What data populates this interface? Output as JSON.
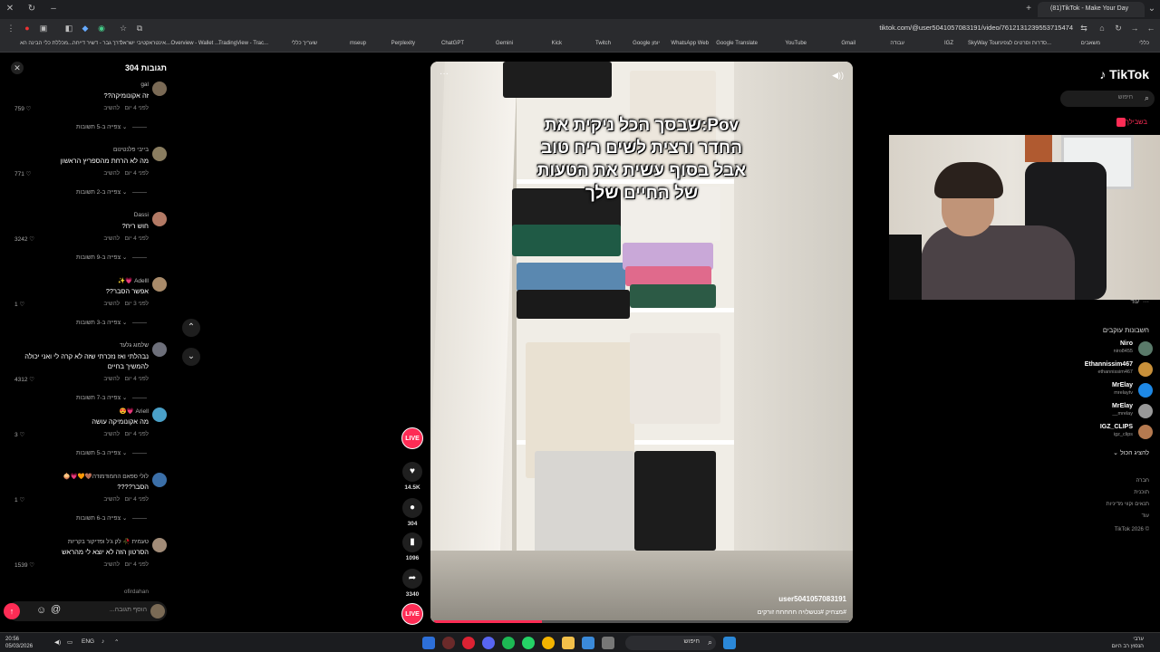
{
  "browser": {
    "tab_title": "(81)TikTok - Make Your Day",
    "url": "tiktok.com/@user5041057083191/video/7612131239553715474",
    "bookmarks": [
      "כללי",
      "משאבים",
      "סדרות וסרטים לצפי...",
      "SkyWay Tours",
      "IGZ",
      "עבודה",
      "Gmail",
      "YouTube",
      "Google Translate",
      "WhatsApp Web",
      "Google יומן",
      "Twitch",
      "Kick",
      "Gemini",
      "ChatGPT",
      "Perplexity",
      "mseup",
      "שעריך כללי",
      "TradingView - Trac...",
      "Overview - Wallet ...",
      "אינטראקטיבי ישראל...",
      "דרך גבר - דשיר דייחה",
      "מכללת כלי הבינה הא..."
    ]
  },
  "comments_panel": {
    "title": "תגובות 304",
    "items": [
      {
        "user": "gal",
        "text": "זה אקונומיקה??",
        "time": "לפני 4 יום",
        "reply": "להשיב",
        "likes": "759",
        "view_replies": "צפייה ב-5 תשובות"
      },
      {
        "user": "בייבי פלנטינום",
        "text": "מה לא הרחת מהספריץ הראשון",
        "time": "לפני 4 יום",
        "reply": "להשיב",
        "likes": "771",
        "view_replies": "צפייה ב-2 תשובות"
      },
      {
        "user": "Dassi",
        "text": "חוש ריח?",
        "time": "לפני 4 יום",
        "reply": "להשיב",
        "likes": "3242",
        "view_replies": "צפייה ב-9 תשובות"
      },
      {
        "user": "Adelll 💗✨",
        "text": "אפשר הסבר??",
        "time": "לפני 3 יום",
        "reply": "להשיב",
        "likes": "1",
        "view_replies": "צפייה ב-3 תשובות"
      },
      {
        "user": "שלמוג גלעד",
        "text": "נבהלתי ואז נזכרתי שזה לא קרה לי ואני יכולה להמשיך בחיים",
        "time": "לפני 4 יום",
        "reply": "להשיב",
        "likes": "4312",
        "view_replies": "צפייה ב-7 תשובות"
      },
      {
        "user": "Ariell 💗😍",
        "text": "מה אקונומיקה עושה",
        "time": "לפני 4 יום",
        "reply": "להשיב",
        "likes": "3",
        "view_replies": "צפייה ב-5 תשובות"
      },
      {
        "user": "לולי ספאם החמודמודה🤎🧡💗🧅",
        "text": "הסבר????",
        "time": "לפני 4 יום",
        "reply": "להשיב",
        "likes": "1",
        "view_replies": "צפייה ב-6 תשובות"
      },
      {
        "user": "טעמית 🥀 לק ג'ל ופדיקור בקריות",
        "text": "הסרטון הזה לא יוצא לי מהראש",
        "time": "לפני 4 יום",
        "reply": "להשיב",
        "likes": "1539",
        "view_replies": ""
      }
    ],
    "last_user": "ofirdahan",
    "input_placeholder": "הוסף תגובה..."
  },
  "video": {
    "overlay_text": [
      "Pov:שבסך הכל ניקית את",
      "החדר ורצית לשים ריח טוב",
      "אבל בסוף עשית את הטעות",
      "של החיים שלך"
    ],
    "username": "user5041057083191",
    "caption": "#מצחיק #נטשלויה חחחחח זורקים",
    "progress": 0.26
  },
  "actions": {
    "live_label": "LIVE",
    "likes": "14.5K",
    "comments": "304",
    "saves": "1096",
    "shares": "3340"
  },
  "sidebar": {
    "logo": "TikTok",
    "search_placeholder": "חיפוש",
    "for_you": "בשבילך",
    "more": "עוד",
    "following_title": "חשבונות עוקבים",
    "following": [
      {
        "name": "Niro",
        "handle": "niro8455"
      },
      {
        "name": "Ethannissim467",
        "handle": "ethannissim467"
      },
      {
        "name": "MrElay",
        "handle": "mrelaytv"
      },
      {
        "name": "MrElay",
        "handle": "__mrelay"
      },
      {
        "name": "IGZ_CLIPS",
        "handle": "igz_clips"
      }
    ],
    "show_all": "להציג הכול",
    "footer_links": [
      "חברה",
      "תוכנית",
      "תנאים וקווי מדיניות",
      "עוד"
    ],
    "copyright": "© TikTok 2026"
  },
  "taskbar": {
    "time": "20:56",
    "date": "05/03/2026",
    "lang": "ENG",
    "search": "חיפוש",
    "weather_title": "ערבי",
    "weather_sub": "הנפוץ רב היום"
  },
  "colors": {
    "accent": "#fe2c55",
    "bg": "#000000"
  }
}
